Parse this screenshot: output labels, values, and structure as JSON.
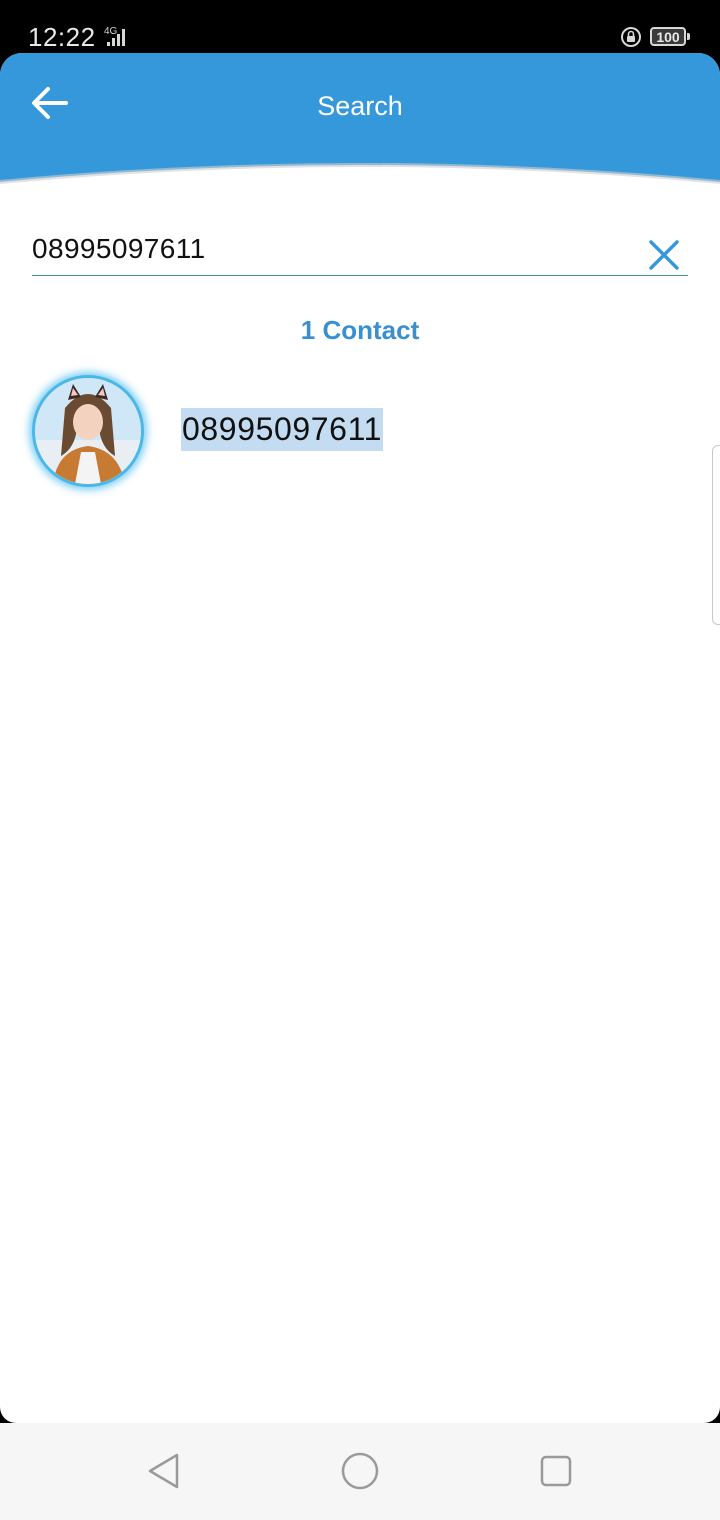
{
  "status_bar": {
    "time": "12:22",
    "network": "4G",
    "battery": "100",
    "icons": [
      "signal-icon",
      "screen-lock-icon",
      "battery-icon"
    ]
  },
  "header": {
    "title": "Search",
    "back_icon": "arrow-left-icon",
    "color": "#3498db"
  },
  "search": {
    "value": "08995097611",
    "clear_icon": "close-icon"
  },
  "results": {
    "count_label": "1 Contact",
    "contacts": [
      {
        "number": "08995097611",
        "avatar_icon": "contact-photo"
      }
    ]
  },
  "nav": {
    "icons": [
      "back-triangle-icon",
      "home-circle-icon",
      "recents-square-icon"
    ]
  },
  "colors": {
    "accent": "#3498db",
    "count_text": "#3a8fd0",
    "highlight": "#c4dcf2",
    "underline": "#4a9a8c"
  }
}
